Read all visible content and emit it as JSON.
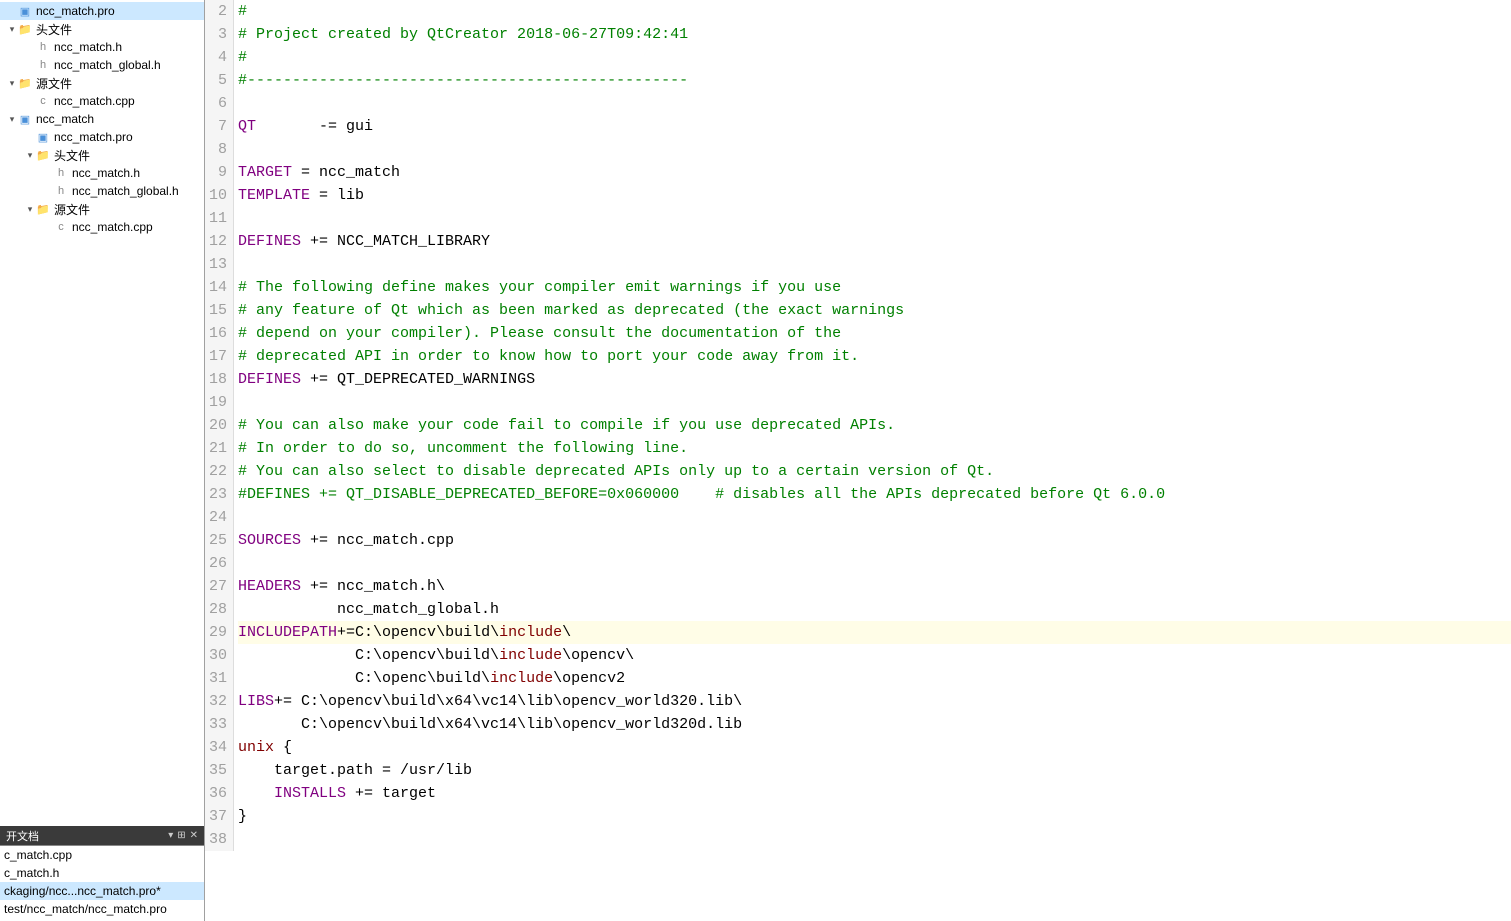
{
  "tree": [
    {
      "label": "ncc_match.pro",
      "indent": 0,
      "arrow": "",
      "icon": "pro",
      "selected": true
    },
    {
      "label": "头文件",
      "indent": 0,
      "arrow": "▾",
      "icon": "folder"
    },
    {
      "label": "ncc_match.h",
      "indent": 1,
      "arrow": "",
      "icon": "h"
    },
    {
      "label": "ncc_match_global.h",
      "indent": 1,
      "arrow": "",
      "icon": "h"
    },
    {
      "label": "源文件",
      "indent": 0,
      "arrow": "▾",
      "icon": "folder"
    },
    {
      "label": "ncc_match.cpp",
      "indent": 1,
      "arrow": "",
      "icon": "cpp"
    },
    {
      "label": "ncc_match",
      "indent": 0,
      "arrow": "▾",
      "icon": "pro"
    },
    {
      "label": "ncc_match.pro",
      "indent": 1,
      "arrow": "",
      "icon": "pro"
    },
    {
      "label": "头文件",
      "indent": 1,
      "arrow": "▾",
      "icon": "folder"
    },
    {
      "label": "ncc_match.h",
      "indent": 2,
      "arrow": "",
      "icon": "h"
    },
    {
      "label": "ncc_match_global.h",
      "indent": 2,
      "arrow": "",
      "icon": "h"
    },
    {
      "label": "源文件",
      "indent": 1,
      "arrow": "▾",
      "icon": "folder"
    },
    {
      "label": "ncc_match.cpp",
      "indent": 2,
      "arrow": "",
      "icon": "cpp"
    }
  ],
  "openDocsHeader": "开文档",
  "openDocs": [
    {
      "label": "c_match.cpp"
    },
    {
      "label": "c_match.h"
    },
    {
      "label": "ckaging/ncc...ncc_match.pro*",
      "selected": true
    },
    {
      "label": "test/ncc_match/ncc_match.pro"
    }
  ],
  "code": [
    {
      "n": 2,
      "spans": [
        {
          "cls": "c",
          "t": "#"
        }
      ]
    },
    {
      "n": 3,
      "spans": [
        {
          "cls": "c",
          "t": "# Project created by QtCreator 2018-06-27T09:42:41"
        }
      ]
    },
    {
      "n": 4,
      "spans": [
        {
          "cls": "c",
          "t": "#"
        }
      ]
    },
    {
      "n": 5,
      "spans": [
        {
          "cls": "c",
          "t": "#-------------------------------------------------"
        }
      ]
    },
    {
      "n": 6,
      "spans": []
    },
    {
      "n": 7,
      "spans": [
        {
          "cls": "kw",
          "t": "QT"
        },
        {
          "cls": "pl",
          "t": "       -= gui"
        }
      ]
    },
    {
      "n": 8,
      "spans": []
    },
    {
      "n": 9,
      "spans": [
        {
          "cls": "kw",
          "t": "TARGET"
        },
        {
          "cls": "pl",
          "t": " = ncc_match"
        }
      ]
    },
    {
      "n": 10,
      "spans": [
        {
          "cls": "kw",
          "t": "TEMPLATE"
        },
        {
          "cls": "pl",
          "t": " = lib"
        }
      ]
    },
    {
      "n": 11,
      "spans": []
    },
    {
      "n": 12,
      "spans": [
        {
          "cls": "kw",
          "t": "DEFINES"
        },
        {
          "cls": "pl",
          "t": " += NCC_MATCH_LIBRARY"
        }
      ]
    },
    {
      "n": 13,
      "spans": []
    },
    {
      "n": 14,
      "spans": [
        {
          "cls": "c",
          "t": "# The following define makes your compiler emit warnings if you use"
        }
      ]
    },
    {
      "n": 15,
      "spans": [
        {
          "cls": "c",
          "t": "# any feature of Qt which as been marked as deprecated (the exact warnings"
        }
      ]
    },
    {
      "n": 16,
      "spans": [
        {
          "cls": "c",
          "t": "# depend on your compiler). Please consult the documentation of the"
        }
      ]
    },
    {
      "n": 17,
      "spans": [
        {
          "cls": "c",
          "t": "# deprecated API in order to know how to port your code away from it."
        }
      ]
    },
    {
      "n": 18,
      "spans": [
        {
          "cls": "kw",
          "t": "DEFINES"
        },
        {
          "cls": "pl",
          "t": " += QT_DEPRECATED_WARNINGS"
        }
      ]
    },
    {
      "n": 19,
      "spans": []
    },
    {
      "n": 20,
      "spans": [
        {
          "cls": "c",
          "t": "# You can also make your code fail to compile if you use deprecated APIs."
        }
      ]
    },
    {
      "n": 21,
      "spans": [
        {
          "cls": "c",
          "t": "# In order to do so, uncomment the following line."
        }
      ]
    },
    {
      "n": 22,
      "spans": [
        {
          "cls": "c",
          "t": "# You can also select to disable deprecated APIs only up to a certain version of Qt."
        }
      ]
    },
    {
      "n": 23,
      "spans": [
        {
          "cls": "c",
          "t": "#DEFINES += QT_DISABLE_DEPRECATED_BEFORE=0x060000    # disables all the APIs deprecated before Qt 6.0.0"
        }
      ]
    },
    {
      "n": 24,
      "spans": []
    },
    {
      "n": 25,
      "spans": [
        {
          "cls": "kw",
          "t": "SOURCES"
        },
        {
          "cls": "pl",
          "t": " += ncc_match.cpp"
        }
      ]
    },
    {
      "n": 26,
      "spans": []
    },
    {
      "n": 27,
      "spans": [
        {
          "cls": "kw",
          "t": "HEADERS"
        },
        {
          "cls": "pl",
          "t": " += ncc_match.h\\"
        }
      ]
    },
    {
      "n": 28,
      "spans": [
        {
          "cls": "pl",
          "t": "           ncc_match_global.h"
        }
      ]
    },
    {
      "n": 29,
      "current": true,
      "spans": [
        {
          "cls": "kw",
          "t": "INCLUDEPATH"
        },
        {
          "cls": "pl",
          "t": "+=C:\\opencv\\build\\"
        },
        {
          "cls": "id",
          "t": "include"
        },
        {
          "cls": "pl",
          "t": "\\"
        }
      ]
    },
    {
      "n": 30,
      "spans": [
        {
          "cls": "pl",
          "t": "             C:\\opencv\\build\\"
        },
        {
          "cls": "id",
          "t": "include"
        },
        {
          "cls": "pl",
          "t": "\\opencv\\"
        }
      ]
    },
    {
      "n": 31,
      "spans": [
        {
          "cls": "pl",
          "t": "             C:\\openc\\build\\"
        },
        {
          "cls": "id",
          "t": "include"
        },
        {
          "cls": "pl",
          "t": "\\opencv2"
        }
      ]
    },
    {
      "n": 32,
      "spans": [
        {
          "cls": "kw",
          "t": "LIBS"
        },
        {
          "cls": "pl",
          "t": "+= C:\\opencv\\build\\x64\\vc14\\lib\\opencv_world320.lib\\"
        }
      ]
    },
    {
      "n": 33,
      "spans": [
        {
          "cls": "pl",
          "t": "       C:\\opencv\\build\\x64\\vc14\\lib\\opencv_world320d.lib"
        }
      ]
    },
    {
      "n": 34,
      "spans": [
        {
          "cls": "id",
          "t": "unix"
        },
        {
          "cls": "pl",
          "t": " {"
        }
      ]
    },
    {
      "n": 35,
      "spans": [
        {
          "cls": "pl",
          "t": "    target.path = /usr/lib"
        }
      ]
    },
    {
      "n": 36,
      "spans": [
        {
          "cls": "kw",
          "t": "    INSTALLS"
        },
        {
          "cls": "pl",
          "t": " += target"
        }
      ]
    },
    {
      "n": 37,
      "spans": [
        {
          "cls": "pl",
          "t": "}"
        }
      ]
    },
    {
      "n": 38,
      "spans": []
    }
  ]
}
